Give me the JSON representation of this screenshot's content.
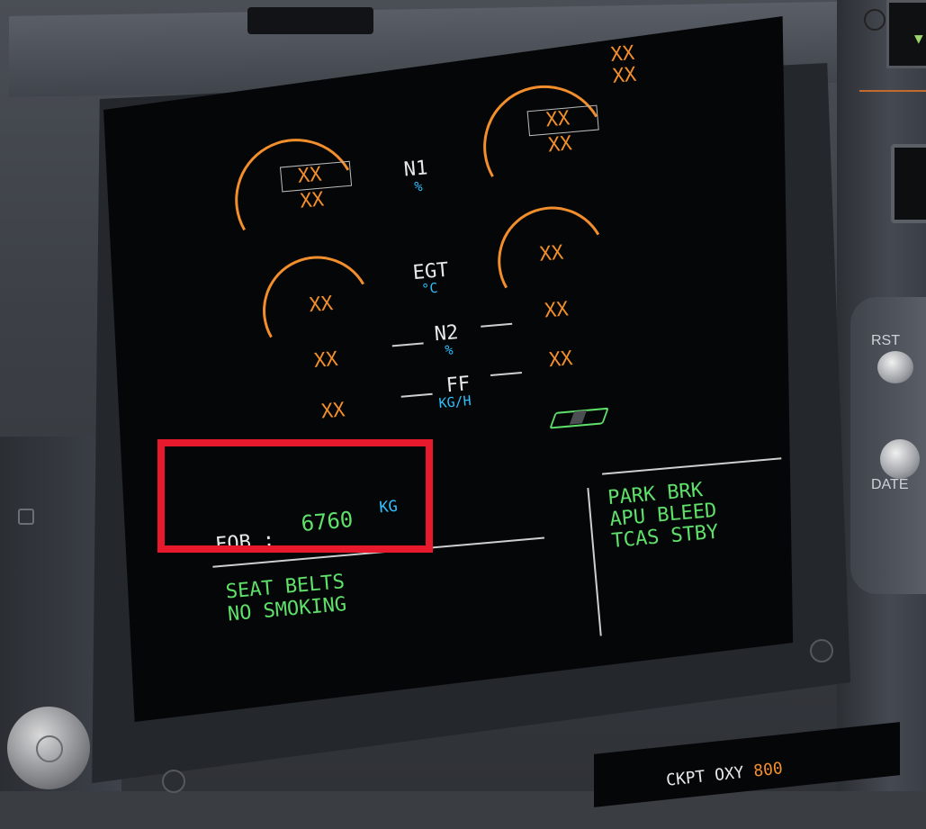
{
  "ecam": {
    "n1": {
      "label": "N1",
      "unit": "%"
    },
    "egt": {
      "label": "EGT",
      "unit": "°C"
    },
    "n2": {
      "label": "N2",
      "unit": "%"
    },
    "ff": {
      "label": "FF",
      "unit": "KG/H"
    },
    "invalid": "XX",
    "fob": {
      "label": "FOB :",
      "value": "6760",
      "unit": "KG"
    },
    "memo_left": [
      "SEAT BELTS",
      "NO SMOKING"
    ],
    "memo_right": [
      "PARK BRK",
      "APU BLEED",
      "TCAS STBY"
    ]
  },
  "panel": {
    "rst_label": "RST",
    "date_label": "DATE",
    "bottom_label": "CKPT OXY",
    "bottom_value": "800"
  },
  "colors": {
    "amber": "#f28e2b",
    "green": "#5fe06a",
    "cyan": "#2ec0ff",
    "highlight": "#e8192c"
  }
}
